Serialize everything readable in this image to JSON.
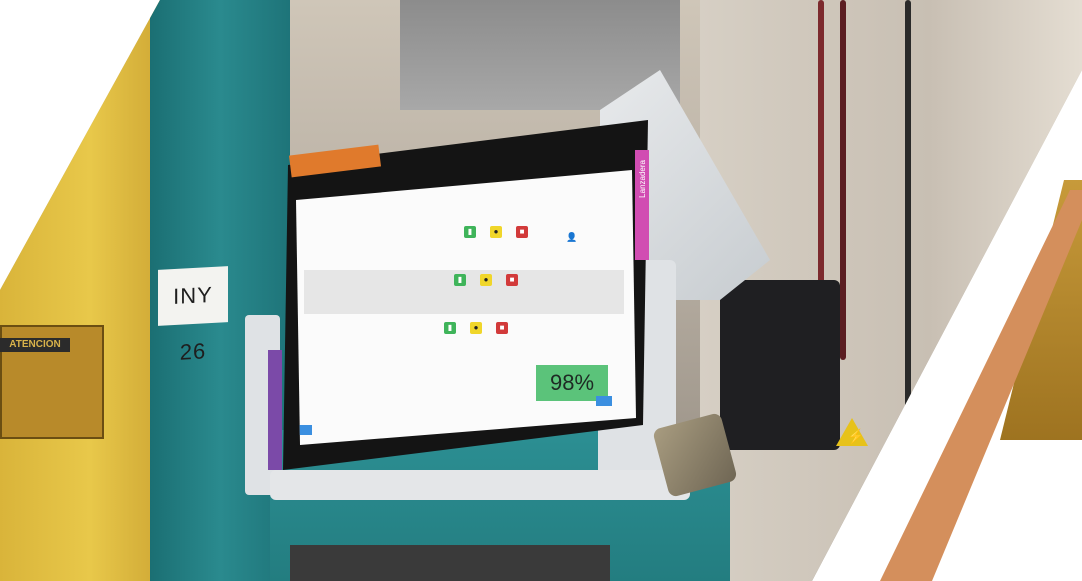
{
  "machine_label": "INY 26",
  "warning_plate": {
    "title": "ATENCION"
  },
  "tablet": {
    "header_tag": "",
    "side_tab_right": "Lanzadera",
    "side_tab_left": "",
    "brand": "",
    "rows": [
      {
        "code": "",
        "name": ""
      },
      {
        "code": "",
        "name": ""
      },
      {
        "code": "",
        "name": ""
      }
    ],
    "efficiency": "98%"
  },
  "colors": {
    "accent_stripe": "#d48f5c",
    "accent_dark": "#a67a24",
    "efficiency_badge": "#5bc37a",
    "machine_teal": "#2a8a8e",
    "pillar_yellow": "#e8c84a"
  },
  "icons": [
    "padlock-icon",
    "hazard-icon",
    "user-icon",
    "status-green-icon",
    "status-yellow-icon",
    "status-red-icon"
  ]
}
